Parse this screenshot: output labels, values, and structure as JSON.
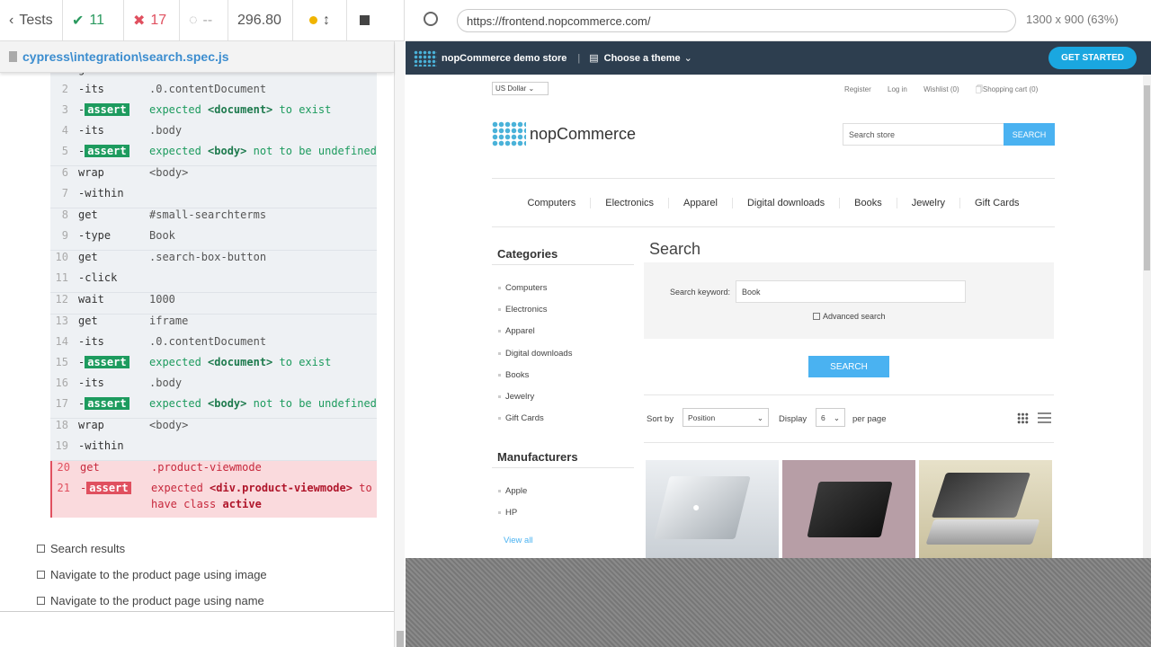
{
  "runner": {
    "tests_label": "Tests",
    "passed": "11",
    "failed": "17",
    "pending": "--",
    "duration": "296.80",
    "spec_path": "cypress\\integration\\search.spec.js"
  },
  "commands": [
    {
      "num": "2",
      "name": "-its",
      "msg": ".0.contentDocument"
    },
    {
      "num": "3",
      "name": "-",
      "badge": "assert",
      "m1": "expected",
      "b1": "<document>",
      "m2": "to exist"
    },
    {
      "num": "4",
      "name": "-its",
      "msg": ".body"
    },
    {
      "num": "5",
      "name": "-",
      "badge": "assert",
      "m1": "expected",
      "b1": "<body>",
      "m2": "not to be undefined"
    },
    {
      "num": "6",
      "name": "wrap",
      "msg": "<body>"
    },
    {
      "num": "7",
      "name": "-within",
      "msg": ""
    },
    {
      "num": "8",
      "name": "get",
      "msg": "#small-searchterms"
    },
    {
      "num": "9",
      "name": "-type",
      "msg": "Book"
    },
    {
      "num": "10",
      "name": "get",
      "msg": ".search-box-button"
    },
    {
      "num": "11",
      "name": "-click",
      "msg": ""
    },
    {
      "num": "12",
      "name": "wait",
      "msg": "1000"
    },
    {
      "num": "13",
      "name": "get",
      "msg": "iframe"
    },
    {
      "num": "14",
      "name": "-its",
      "msg": ".0.contentDocument"
    },
    {
      "num": "15",
      "name": "-",
      "badge": "assert",
      "m1": "expected",
      "b1": "<document>",
      "m2": "to exist"
    },
    {
      "num": "16",
      "name": "-its",
      "msg": ".body"
    },
    {
      "num": "17",
      "name": "-",
      "badge": "assert",
      "m1": "expected",
      "b1": "<body>",
      "m2": "not to be undefined"
    },
    {
      "num": "18",
      "name": "wrap",
      "msg": "<body>"
    },
    {
      "num": "19",
      "name": "-within",
      "msg": ""
    },
    {
      "num": "20",
      "name": "get",
      "msg": ".product-viewmode"
    },
    {
      "num": "21",
      "name": "-",
      "badge": "assert",
      "m1": "expected",
      "b1": "<div.product-viewmode>",
      "m2": "to",
      "m3": "have class",
      "b2": "active"
    }
  ],
  "tests": [
    "Search results",
    "Navigate to the product page using image",
    "Navigate to the product page using name"
  ],
  "browser": {
    "url": "https://frontend.nopcommerce.com/",
    "viewport": "1300 x 900",
    "scale": "(63%)"
  },
  "demo": {
    "title": "nopCommerce demo store",
    "theme": "Choose a theme",
    "get_started": "GET STARTED"
  },
  "store": {
    "currency": "US Dollar",
    "header_links": [
      "Register",
      "Log in",
      "Wishlist (0)",
      "Shopping cart (0)"
    ],
    "logo": "nopCommerce",
    "search_placeholder": "Search store",
    "search_btn": "SEARCH",
    "nav": [
      "Computers",
      "Electronics",
      "Apparel",
      "Digital downloads",
      "Books",
      "Jewelry",
      "Gift Cards"
    ],
    "categories_title": "Categories",
    "categories": [
      "Computers",
      "Electronics",
      "Apparel",
      "Digital downloads",
      "Books",
      "Jewelry",
      "Gift Cards"
    ],
    "manufacturers_title": "Manufacturers",
    "manufacturers": [
      "Apple",
      "HP"
    ],
    "view_all": "View all",
    "page_title": "Search",
    "keyword_label": "Search keyword:",
    "keyword_value": "Book",
    "advanced": "Advanced search",
    "search_button": "SEARCH",
    "sort_by": "Sort by",
    "sort_value": "Position",
    "display": "Display",
    "display_value": "6",
    "per_page": "per page",
    "product_tiles": [
      "Apple laptop",
      "Black laptop",
      "Spectre laptop"
    ]
  }
}
